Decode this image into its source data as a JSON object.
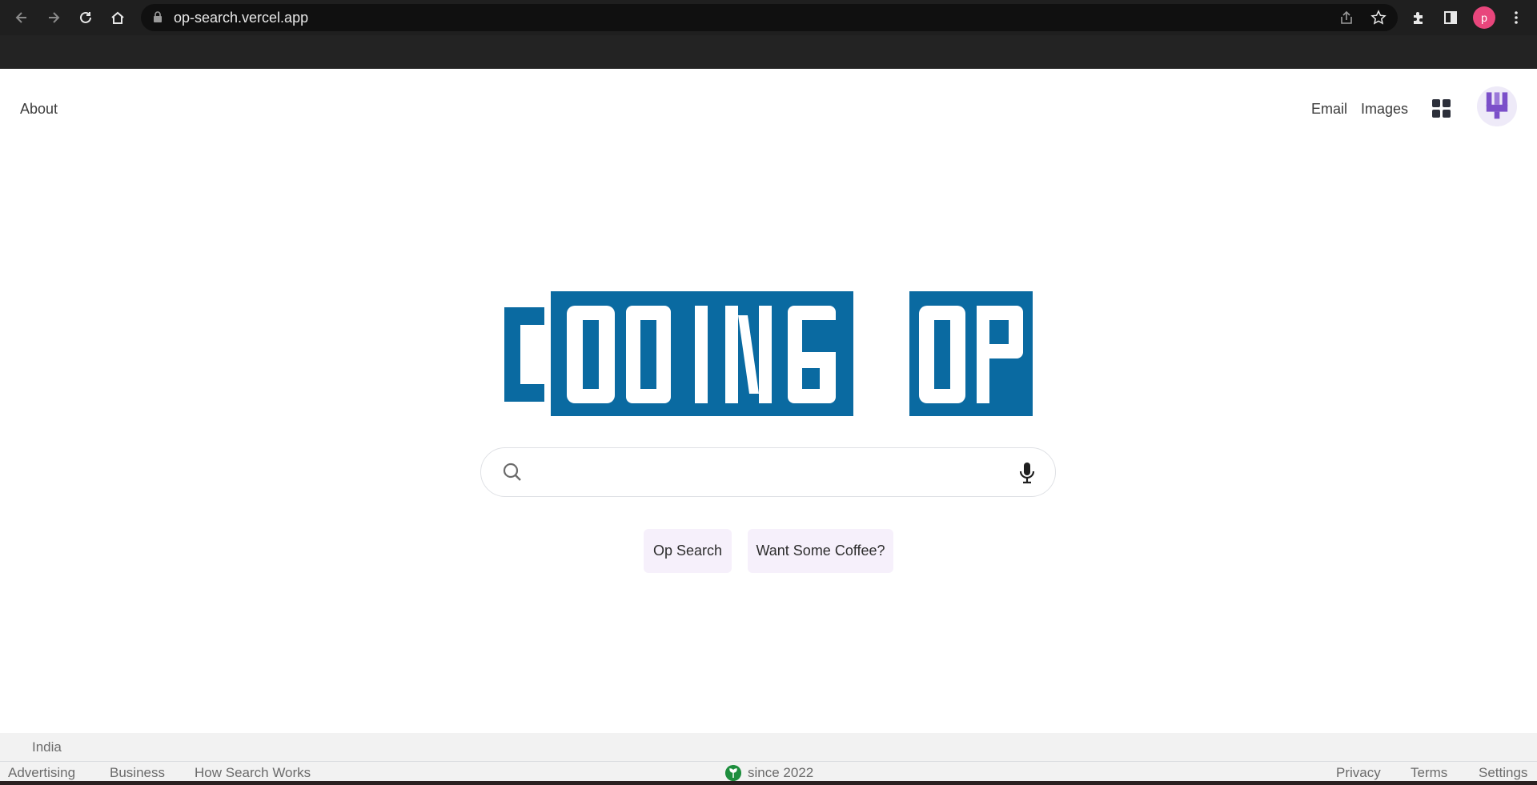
{
  "browser": {
    "url": "op-search.vercel.app",
    "profile_initial": "p"
  },
  "header": {
    "about": "About",
    "email": "Email",
    "images": "Images"
  },
  "logo": {
    "text": "CODING OP",
    "color": "#0a6aa1"
  },
  "search": {
    "placeholder": "",
    "value": ""
  },
  "buttons": {
    "op_search": "Op Search",
    "coffee": "Want Some Coffee?"
  },
  "footer": {
    "country": "India",
    "left_links": [
      "Advertising",
      "Business",
      "How Search Works"
    ],
    "since": "since 2022",
    "right_links": [
      "Privacy",
      "Terms",
      "Settings"
    ]
  }
}
